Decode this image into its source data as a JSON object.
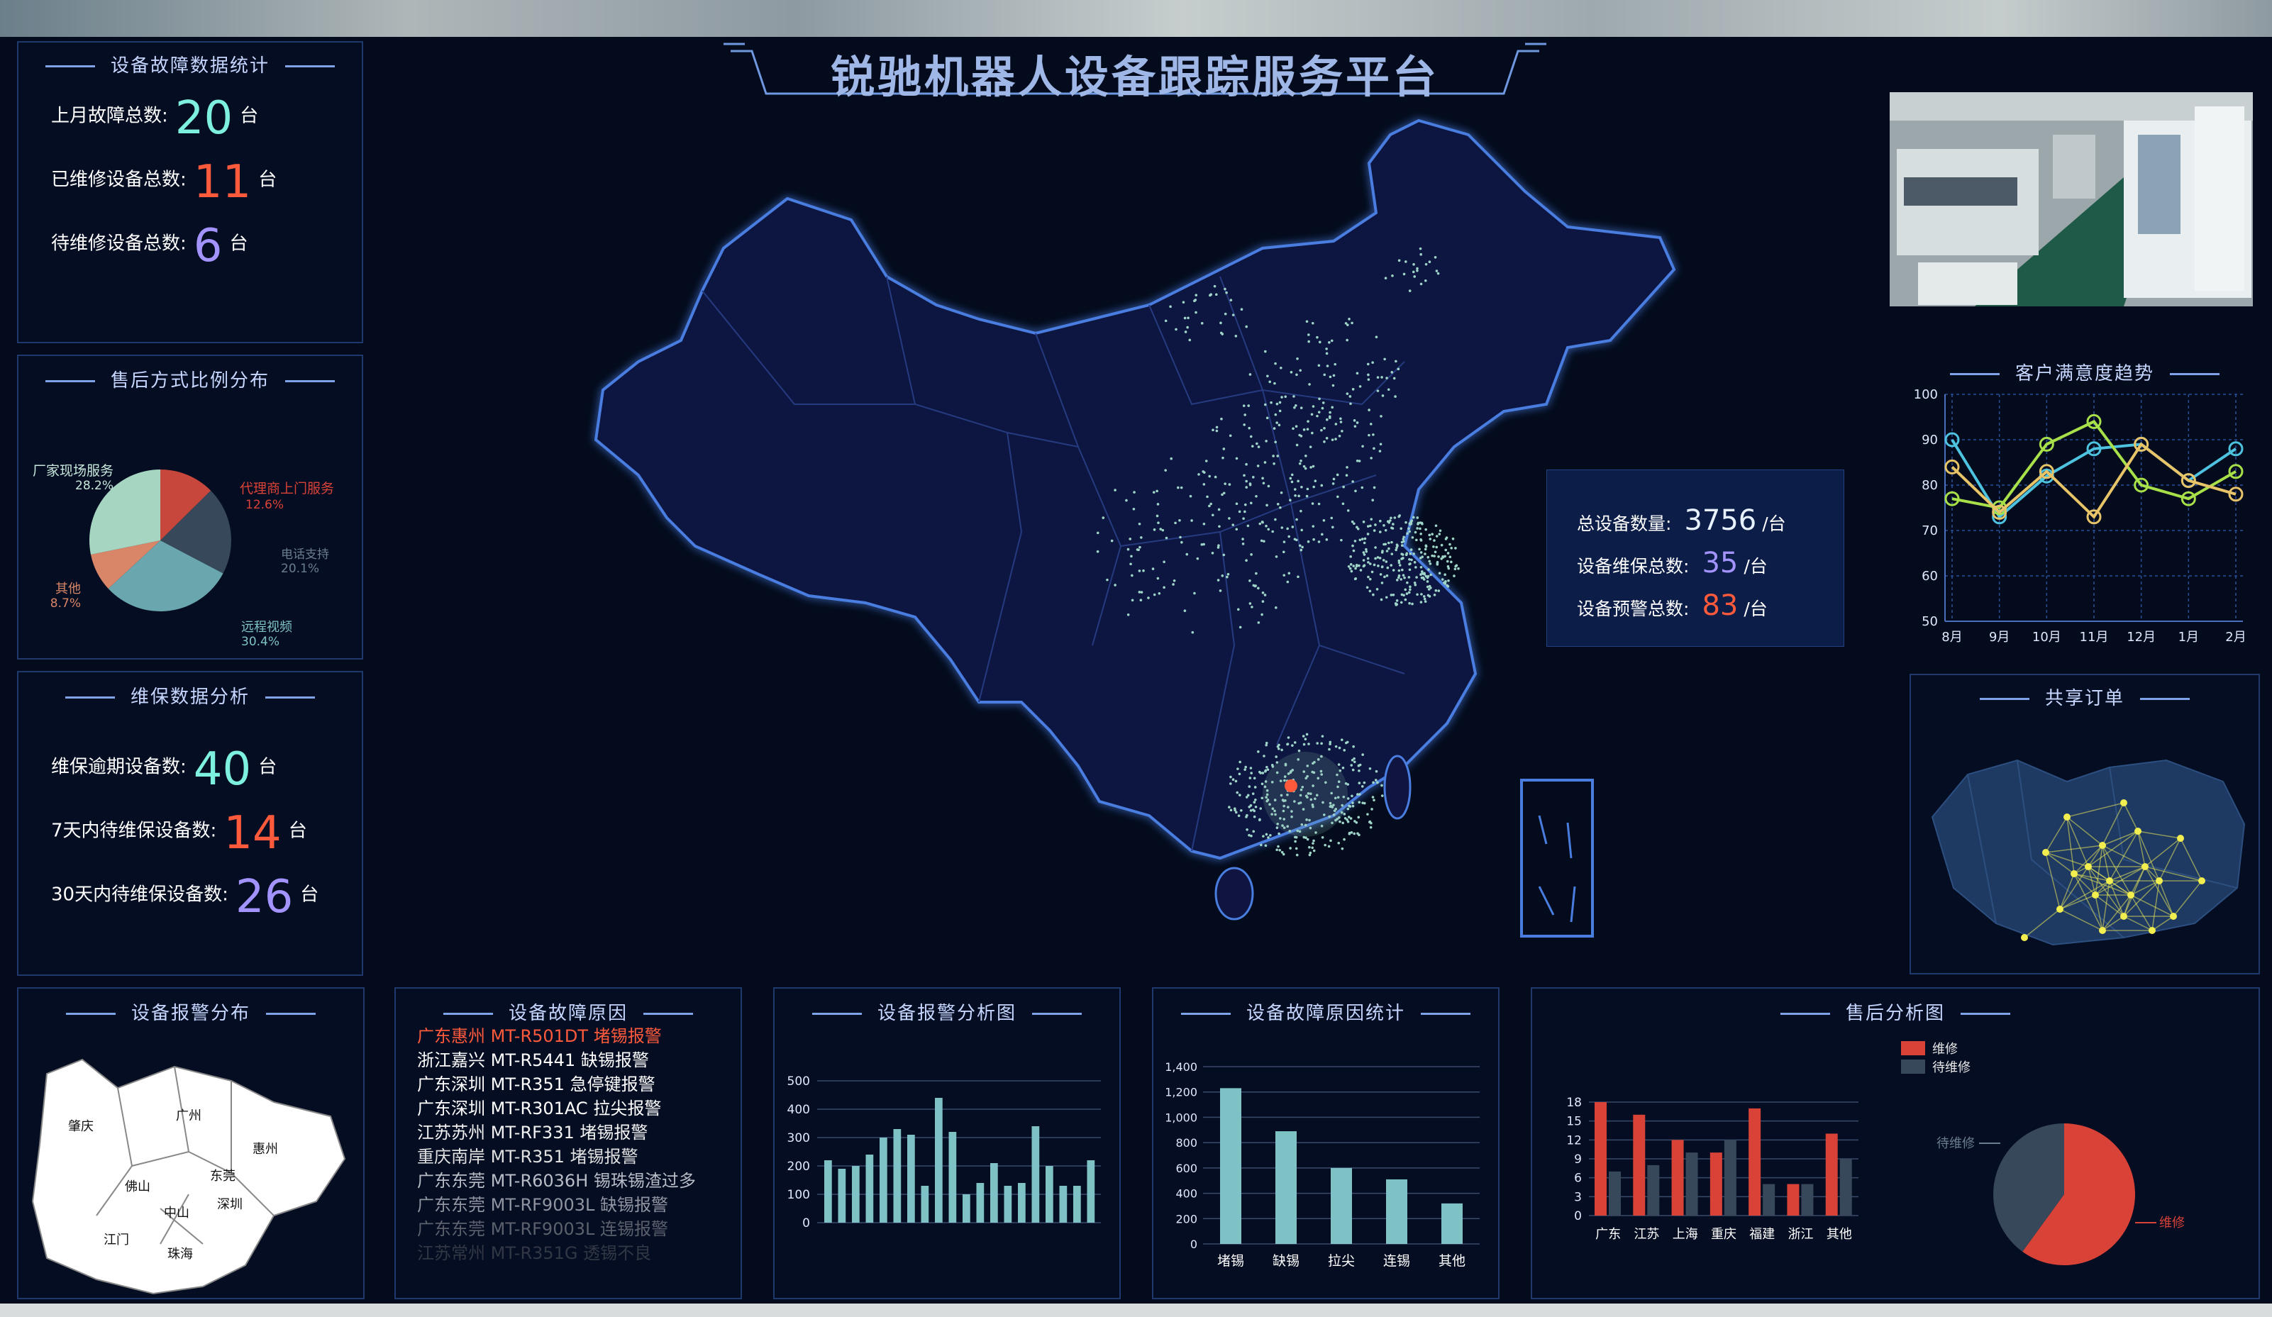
{
  "title": "锐驰机器人设备跟踪服务平台",
  "fault_stats": {
    "title": "设备故障数据统计",
    "items": [
      {
        "label": "上月故障总数:",
        "value": "20",
        "unit": "台",
        "color": "#7ef0e0"
      },
      {
        "label": "已维修设备总数:",
        "value": "11",
        "unit": "台",
        "color": "#ff5a3c"
      },
      {
        "label": "待维修设备总数:",
        "value": "6",
        "unit": "台",
        "color": "#a393ff"
      }
    ]
  },
  "service_ratio": {
    "title": "售后方式比例分布",
    "slices": [
      {
        "name": "代理商上门服务",
        "pct": "12.6%",
        "value": 12.6,
        "color": "#c8473c"
      },
      {
        "name": "电话支持",
        "pct": "20.1%",
        "value": 20.1,
        "color": "#37485a"
      },
      {
        "name": "远程视频",
        "pct": "30.4%",
        "value": 30.4,
        "color": "#6aa6ad"
      },
      {
        "name": "其他",
        "pct": "8.7%",
        "value": 8.7,
        "color": "#d98567"
      },
      {
        "name": "厂家现场服务",
        "pct": "28.2%",
        "value": 28.2,
        "color": "#a6d6c1"
      }
    ]
  },
  "maintenance": {
    "title": "维保数据分析",
    "items": [
      {
        "label": "维保逾期设备数:",
        "value": "40",
        "unit": "台",
        "color": "#7ef0e0"
      },
      {
        "label": "7天内待维保设备数:",
        "value": "14",
        "unit": "台",
        "color": "#ff5a3c"
      },
      {
        "label": "30天内待维保设备数:",
        "value": "26",
        "unit": "台",
        "color": "#a393ff"
      }
    ]
  },
  "alarm_map": {
    "title": "设备报警分布",
    "cities": [
      "肇庆",
      "广州",
      "惠州",
      "佛山",
      "东莞",
      "深圳",
      "中山",
      "江门",
      "珠海"
    ]
  },
  "fault_reasons": {
    "title": "设备故障原因",
    "items": [
      "广东惠州 MT-R501DT 堵锡报警",
      "浙江嘉兴 MT-R5441 缺锡报警",
      "广东深圳 MT-R351 急停键报警",
      "广东深圳 MT-R301AC 拉尖报警",
      "江苏苏州 MT-RF331 堵锡报警",
      "重庆南岸 MT-R351 堵锡报警",
      "广东东莞 MT-R6036H 锡珠锡渣过多",
      "广东东莞 MT-RF9003L 缺锡报警",
      "广东东莞 MT-RF9003L 连锡报警",
      "江苏常州 MT-R351G 透锡不良"
    ]
  },
  "summary": {
    "items": [
      {
        "label": "总设备数量:",
        "value": "3756",
        "unit": "/台",
        "color": "#e8f2ff"
      },
      {
        "label": "设备维保总数:",
        "value": "35",
        "unit": "/台",
        "color": "#a393ff"
      },
      {
        "label": "设备预警总数:",
        "value": "83",
        "unit": "/台",
        "color": "#ff5a3c"
      }
    ]
  },
  "satisfaction": {
    "title": "客户满意度趋势"
  },
  "shared_orders": {
    "title": "共享订单"
  },
  "alarm_analysis": {
    "title": "设备报警分析图"
  },
  "fault_stat": {
    "title": "设备故障原因统计"
  },
  "after_sales": {
    "title": "售后分析图"
  },
  "chart_data": [
    {
      "id": "satisfaction",
      "type": "line",
      "categories": [
        "8月",
        "9月",
        "10月",
        "11月",
        "12月",
        "1月",
        "2月"
      ],
      "ylim": [
        50,
        100
      ],
      "yticks": [
        50,
        60,
        70,
        80,
        90,
        100
      ],
      "grid": true,
      "series": [
        {
          "values": [
            90,
            73,
            82,
            88,
            89,
            81,
            88
          ],
          "color": "#4ec3e0"
        },
        {
          "values": [
            77,
            75,
            89,
            94,
            80,
            77,
            83
          ],
          "color": "#a8e04a"
        },
        {
          "values": [
            84,
            74,
            83,
            73,
            89,
            81,
            78
          ],
          "color": "#e8c468"
        }
      ]
    },
    {
      "id": "alarm_analysis",
      "type": "bar",
      "ylim": [
        0,
        500
      ],
      "yticks": [
        0,
        100,
        200,
        300,
        400,
        500
      ],
      "values": [
        220,
        190,
        200,
        240,
        300,
        330,
        310,
        130,
        440,
        320,
        100,
        140,
        210,
        130,
        140,
        340,
        200,
        130,
        130,
        220
      ],
      "color": "#7fc2c6"
    },
    {
      "id": "fault_stat",
      "type": "bar",
      "categories": [
        "堵锡",
        "缺锡",
        "拉尖",
        "连锡",
        "其他"
      ],
      "values": [
        1230,
        890,
        600,
        510,
        320
      ],
      "ylim": [
        0,
        1400
      ],
      "yticks": [
        0,
        200,
        400,
        600,
        800,
        1000,
        1200,
        1400
      ],
      "color": "#7fc2c6"
    },
    {
      "id": "after_sales_bar",
      "type": "bar",
      "categories": [
        "广东",
        "江苏",
        "上海",
        "重庆",
        "福建",
        "浙江",
        "其他"
      ],
      "ylim": [
        0,
        18
      ],
      "yticks": [
        0,
        3,
        6,
        9,
        12,
        15,
        18
      ],
      "series": [
        {
          "name": "维修",
          "values": [
            18,
            16,
            12,
            10,
            17,
            5,
            13
          ],
          "color": "#d94237"
        },
        {
          "name": "待维修",
          "values": [
            7,
            8,
            10,
            12,
            5,
            5,
            9
          ],
          "color": "#37485a"
        }
      ],
      "legend": "top-right"
    },
    {
      "id": "after_sales_pie",
      "type": "pie",
      "slices": [
        {
          "name": "维修",
          "value": 60,
          "color": "#d94237"
        },
        {
          "name": "待维修",
          "value": 40,
          "color": "#37485a"
        }
      ]
    }
  ]
}
